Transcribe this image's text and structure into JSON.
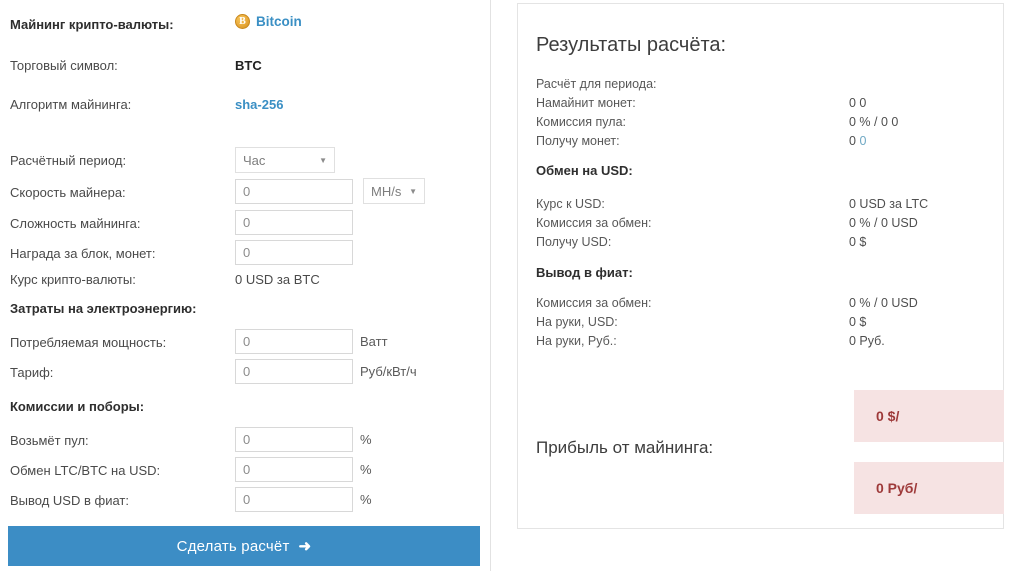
{
  "form": {
    "header_rows": [
      {
        "label": "Майнинг крипто-валюты:",
        "value": "Bitcoin",
        "icon": "bitcoin-coin-icon"
      },
      {
        "label": "Торговый символ:",
        "value": "BTC"
      },
      {
        "label": "Алгоритм майнинга:",
        "value": "sha-256"
      }
    ],
    "period": {
      "label": "Расчётный период:",
      "selected": "Час",
      "caret": "▼"
    },
    "hashrate": {
      "label": "Скорость майнера:",
      "value": "0",
      "placeholder": "0",
      "unit_selected": "MH/s",
      "unit_caret": "▼"
    },
    "difficulty": {
      "label": "Сложность майнинга:",
      "value": "0",
      "placeholder": "0"
    },
    "block_reward": {
      "label": "Награда за блок, монет:",
      "value": "0",
      "placeholder": "0"
    },
    "rate": {
      "label": "Курс крипто-валюты:",
      "value": "0 USD за BTC"
    },
    "power_section_title": "Затраты на электроэнергию:",
    "power": {
      "label": "Потребляемая мощность:",
      "value": "0",
      "placeholder": "0",
      "suffix": "Ватт"
    },
    "tariff": {
      "label": "Тариф:",
      "value": "0",
      "placeholder": "0",
      "suffix": "Руб/кВт/ч"
    },
    "fees_section_title": "Комиссии и поборы:",
    "pool_fee": {
      "label": "Возьмёт пул:",
      "value": "0",
      "placeholder": "0",
      "suffix": "%"
    },
    "exchange_fee": {
      "label": "Обмен LTC/BTC на USD:",
      "value": "0",
      "placeholder": "0",
      "suffix": "%"
    },
    "withdraw_fee": {
      "label": "Вывод USD в фиат:",
      "value": "0",
      "placeholder": "0",
      "suffix": "%"
    },
    "submit": {
      "label": "Сделать расчёт",
      "arrow": "➜"
    }
  },
  "results": {
    "title": "Результаты расчёта:",
    "period_row": {
      "label": "Расчёт для периода:",
      "value": ""
    },
    "mined_row": {
      "label": "Намайнит монет:",
      "value": "0 0"
    },
    "pool_fee_row": {
      "label": "Комиссия пула:",
      "value": "0 % / 0 0"
    },
    "receive_coins_row": {
      "label": "Получу монет:",
      "value_main": "0",
      "value_accent": "0"
    },
    "usd_section_title": "Обмен на USD:",
    "usd_rate_row": {
      "label": "Курс к USD:",
      "value": "0 USD за LTC"
    },
    "usd_fee_row": {
      "label": "Комиссия за обмен:",
      "value": "0 % / 0 USD"
    },
    "usd_receive_row": {
      "label": "Получу USD:",
      "value": "0 $"
    },
    "fiat_section_title": "Вывод в фиат:",
    "fiat_fee_row": {
      "label": "Комиссия за обмен:",
      "value": "0 % / 0 USD"
    },
    "fiat_usd_row": {
      "label": "На руки, USD:",
      "value": "0 $"
    },
    "fiat_rub_row": {
      "label": "На руки, Руб.:",
      "value": "0 Руб."
    },
    "profit_label": "Прибыль от майнинга:",
    "profit_usd": "0 $/",
    "profit_rub": "0 Руб/"
  },
  "colors": {
    "accent_blue": "#3a8fc4",
    "button_blue": "#3c8dc5",
    "coin_gold": "#e8a93a",
    "profit_bg": "#f6e3e3",
    "profit_text": "#9e3a3a",
    "value_accent": "#6fa8c4"
  }
}
